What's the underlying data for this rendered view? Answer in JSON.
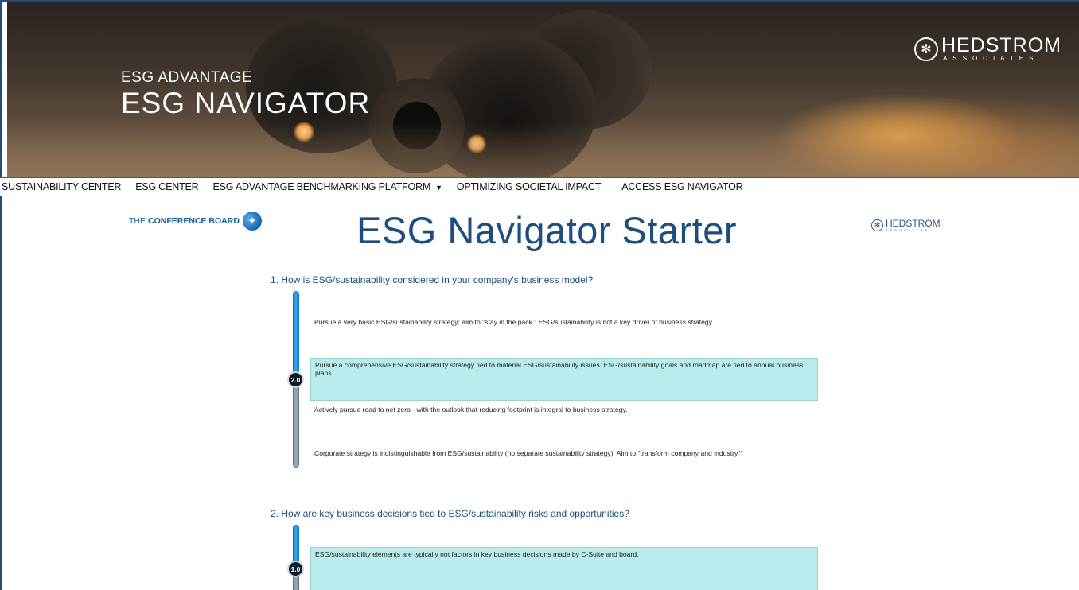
{
  "banner": {
    "subtitle": "ESG ADVANTAGE",
    "title": "ESG NAVIGATOR",
    "logo_name": "HEDSTROM",
    "logo_sub": "ASSOCIATES"
  },
  "nav": {
    "items": [
      {
        "label": "SUSTAINABILITY CENTER"
      },
      {
        "label": "ESG CENTER"
      },
      {
        "label": "ESG ADVANTAGE BENCHMARKING PLATFORM",
        "has_dropdown": true
      },
      {
        "label": "OPTIMIZING SOCIETAL IMPACT"
      },
      {
        "label": "ACCESS ESG NAVIGATOR"
      }
    ]
  },
  "header": {
    "cb_logo_prefix": "THE",
    "cb_logo_name": "CONFERENCE BOARD",
    "page_title": "ESG Navigator Starter",
    "right_logo_name": "HEDSTROM",
    "right_logo_sub": "ASSOCIATES"
  },
  "questions": [
    {
      "text": "1. How is ESG/sustainability considered in your company's business model?",
      "slider_value": "2.0",
      "options": [
        "Pursue a very basic ESG/sustainability strategy; aim to \"stay in the pack.\" ESG/sustainability is not a key driver of business strategy.",
        "Pursue a comprehensive ESG/sustainability strategy tied to material ESG/sustainability issues. ESG/sustainability goals and roadmap are tied to annual business plans.",
        "Actively pursue road to net zero - with the outlook that reducing footprint is integral to business strategy.",
        "Corporate strategy is indistinguishable from ESG/sustainability (no separate sustainability strategy). Aim to \"transform company and industry.\""
      ],
      "selected_index": 1
    },
    {
      "text": "2. How are key business decisions tied to ESG/sustainability risks and opportunities?",
      "slider_value": "1.0",
      "options": [
        "ESG/sustainability elements are typically not factors in key business decisions made by C-Suite and board."
      ],
      "selected_index": 0
    }
  ],
  "colors": {
    "title_blue": "#1d4e7e",
    "selected_bg": "#b9ecec",
    "slider_fill": "#1a8bd0"
  }
}
